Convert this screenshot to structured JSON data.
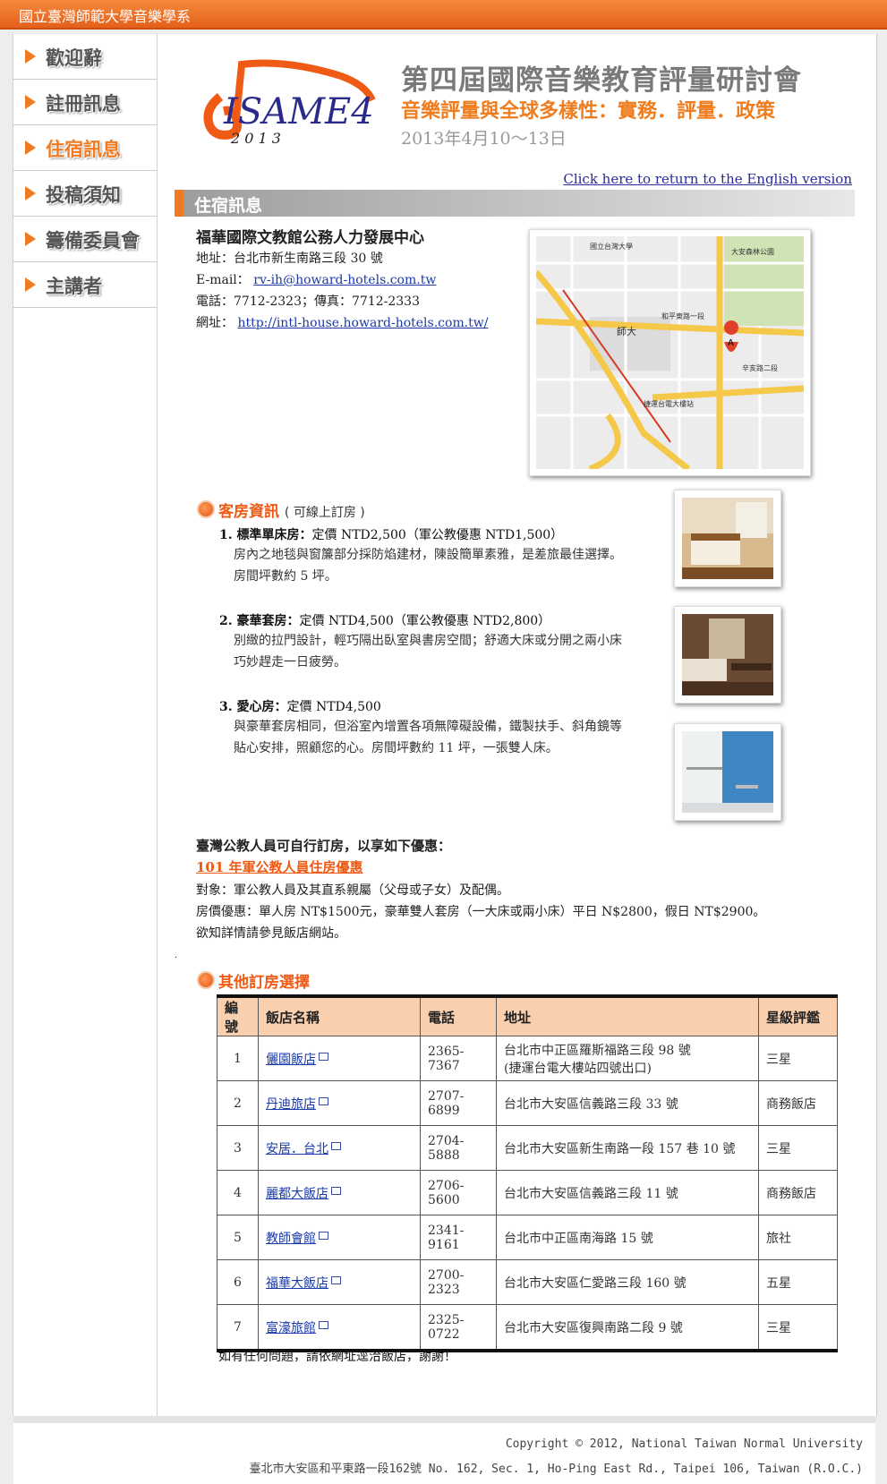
{
  "site_name": "國立臺灣師範大學音樂學系",
  "nav": [
    {
      "label": "歡迎辭",
      "active": false
    },
    {
      "label": "註冊訊息",
      "active": false
    },
    {
      "label": "住宿訊息",
      "active": true
    },
    {
      "label": "投稿須知",
      "active": false
    },
    {
      "label": "籌備委員會",
      "active": false
    },
    {
      "label": "主講者",
      "active": false
    }
  ],
  "header": {
    "logo_text": "ISAME4",
    "logo_year": "2 0 1 3",
    "title": "第四屆國際音樂教育評量研討會",
    "subtitle": "音樂評量與全球多樣性：實務．評量．政策",
    "date": "2013年4月10～13日",
    "english_link": "Click here to return to the English version"
  },
  "section_title": "住宿訊息",
  "hotel": {
    "name": "福華國際文教館公務人力發展中心",
    "address_label": "地址：",
    "address": "台北市新生南路三段 30 號",
    "email_label": "E-mail：",
    "email": "rv-ih@howard-hotels.com.tw",
    "phone_line": "電話：7712-2323；傳真：7712-2333",
    "web_label": "網址：",
    "web": "http://intl-house.howard-hotels.com.tw/"
  },
  "map_labels": {
    "univ": "國立台灣大學",
    "park": "大安森林公園",
    "ntnu": "師大",
    "station": "捷運台電大樓站",
    "road1": "和平東路一段",
    "road2": "辛亥路二段",
    "marker": "A"
  },
  "rooms_section": {
    "title": "客房資訊",
    "note": "( 可線上訂房 )"
  },
  "rooms": [
    {
      "title": "1. 標準單床房：",
      "price": "定價 NTD2,500（軍公教優惠 NTD1,500）",
      "desc1": "房內之地毯與窗簾部分採防焰建材，陳設簡單素雅，是差旅最佳選擇。",
      "desc2": "房間坪數約 5 坪。"
    },
    {
      "title": "2. 豪華套房：",
      "price": "定價 NTD4,500（軍公教優惠 NTD2,800）",
      "desc1": "別緻的拉門設計，輕巧隔出臥室與書房空間；舒適大床或分開之兩小床",
      "desc2": "巧妙趕走一日疲勞。"
    },
    {
      "title": "3. 愛心房：",
      "price": "定價 NTD4,500",
      "desc1": "與豪華套房相同，但浴室內增置各項無障礙設備，鐵製扶手、斜角鏡等",
      "desc2": "貼心安排，照顧您的心。房間坪數約 11 坪，一張雙人床。"
    }
  ],
  "gov": {
    "title": "臺灣公教人員可自行訂房，以享如下優惠：",
    "link": "101 年軍公教人員住房優惠",
    "line1": "對象：軍公教人員及其直系親屬（父母或子女）及配偶。",
    "line2": "房價優惠：單人房 NT$1500元，豪華雙人套房（一大床或兩小床）平日 N$2800，假日 NT$2900。",
    "line3": "欲知詳情請參見飯店網站。"
  },
  "other_section_title": "其他訂房選擇",
  "table": {
    "headers": [
      "編號",
      "飯店名稱",
      "電話",
      "地址",
      "星級評鑑"
    ],
    "rows": [
      {
        "no": "1",
        "name": "儷園飯店",
        "phone": "2365-7367",
        "addr": "台北市中正區羅斯福路三段 98 號",
        "addr2": "(捷運台電大樓站四號出口)",
        "rating": "三星"
      },
      {
        "no": "2",
        "name": "丹迪旅店",
        "phone": "2707-6899",
        "addr": "台北市大安區信義路三段 33 號",
        "addr2": "",
        "rating": "商務飯店"
      },
      {
        "no": "3",
        "name": "安居．台北",
        "phone": "2704-5888",
        "addr": "台北市大安區新生南路一段 157 巷 10 號",
        "addr2": "",
        "rating": "三星"
      },
      {
        "no": "4",
        "name": "麗都大飯店",
        "phone": "2706-5600",
        "addr": "台北市大安區信義路三段 11 號",
        "addr2": "",
        "rating": "商務飯店"
      },
      {
        "no": "5",
        "name": "教師會館",
        "phone": "2341-9161",
        "addr": "台北市中正區南海路 15 號",
        "addr2": "",
        "rating": "旅社"
      },
      {
        "no": "6",
        "name": "福華大飯店",
        "phone": "2700-2323",
        "addr": "台北市大安區仁愛路三段 160 號",
        "addr2": "",
        "rating": "五星"
      },
      {
        "no": "7",
        "name": "富濠旅館",
        "phone": "2325-0722",
        "addr": "台北市大安區復興南路二段 9 號",
        "addr2": "",
        "rating": "三星"
      }
    ]
  },
  "closing": "如有任何問題，請依網址逕洽飯店，謝謝！",
  "footer": {
    "copyright": "Copyright © 2012, National Taiwan Normal University",
    "address": "臺北市大安區和平東路一段162號 No. 162, Sec. 1, Ho-Ping East Rd., Taipei 106, Taiwan (R.O.C.)"
  },
  "colors": {
    "accent": "#f07a22",
    "header_bar": "#e4601a",
    "table_head": "#f9cfae",
    "link": "#1a3aa8"
  }
}
